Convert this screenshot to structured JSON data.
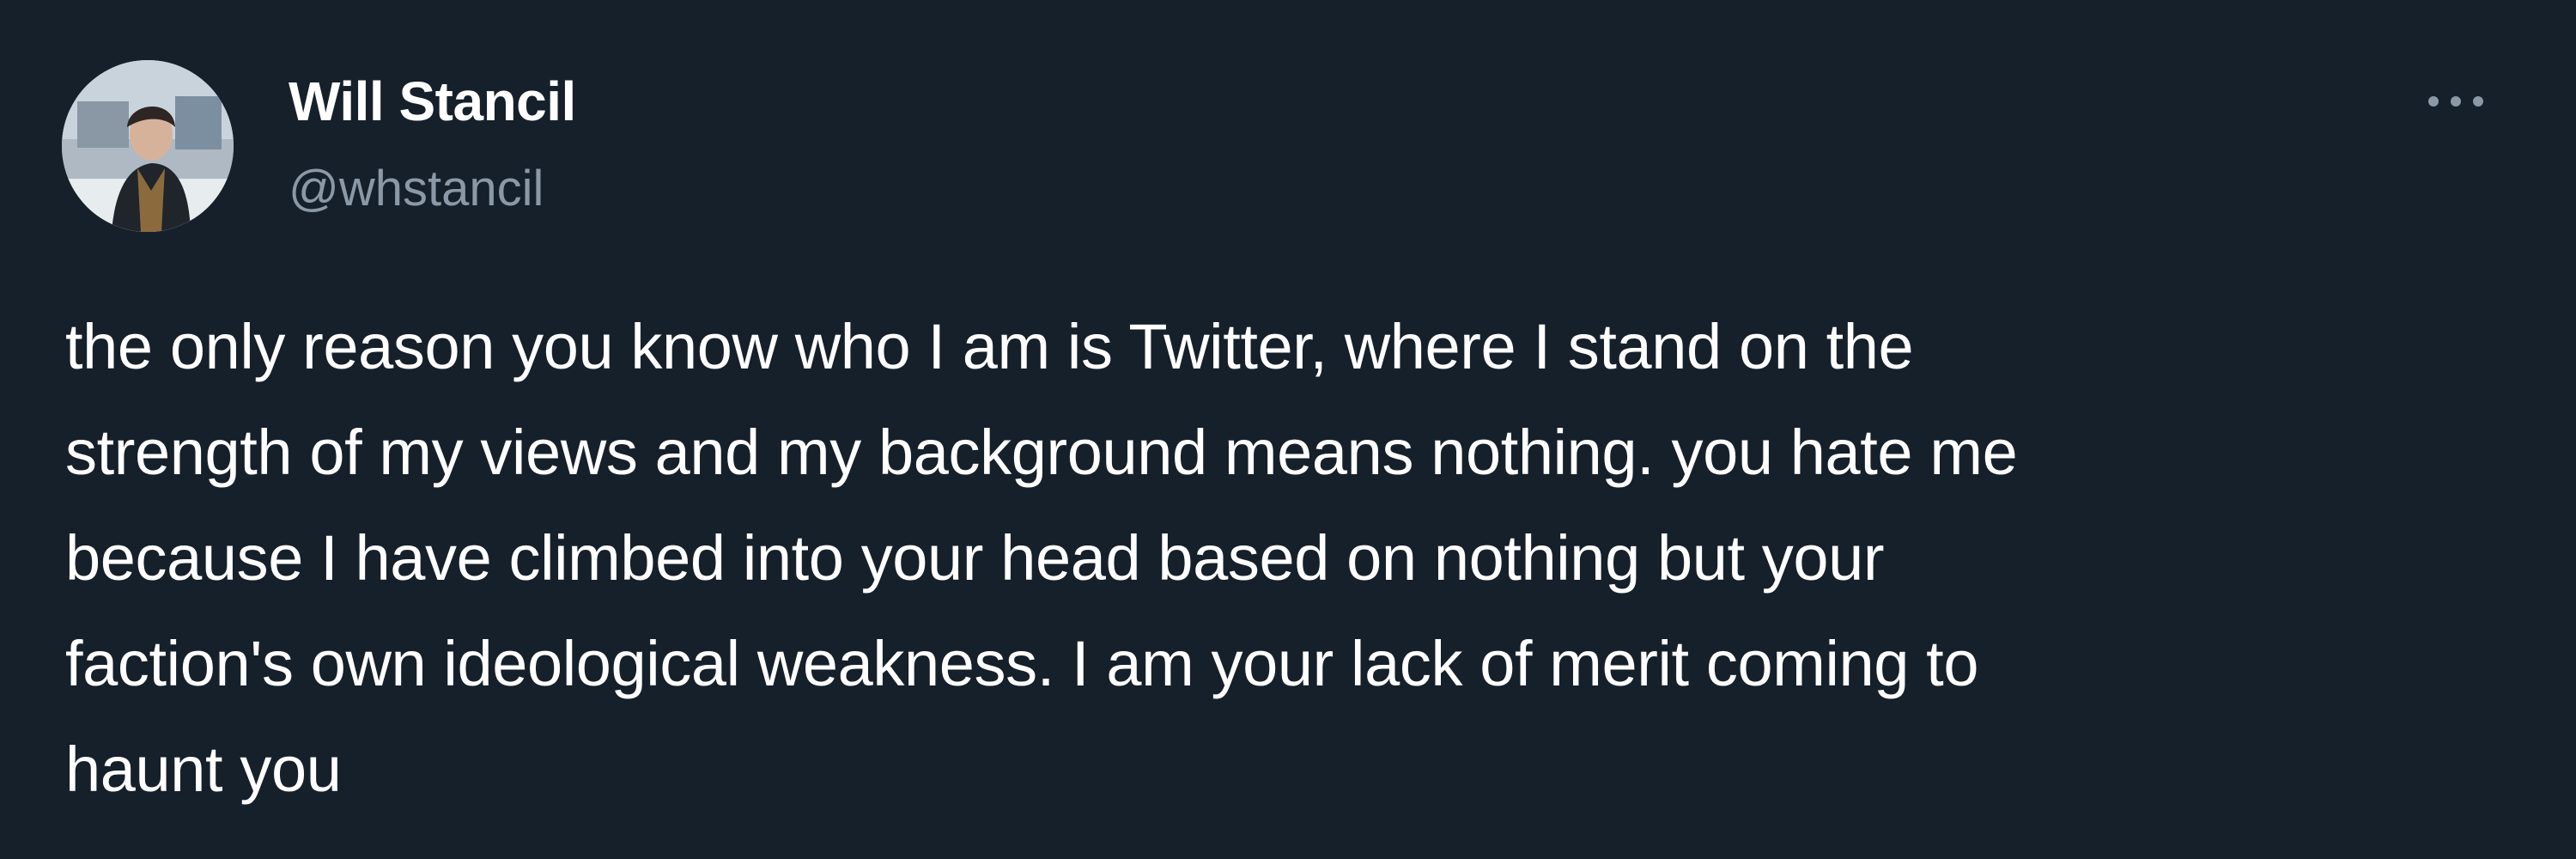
{
  "tweet": {
    "author": {
      "display_name": "Will Stancil",
      "handle": "@whstancil",
      "avatar_icon": "profile-photo"
    },
    "more_menu": {
      "icon": "more-horizontal-icon"
    },
    "text": "the only reason you know who I am is Twitter, where I stand on the\nstrength of my views and my background means nothing. you hate me\nbecause I have climbed into your head based on nothing but your\nfaction's own ideological weakness. I am your lack of merit coming to\nhaunt you"
  },
  "colors": {
    "background": "#16202b",
    "primary_text": "#ffffff",
    "secondary_text": "#8b98a5"
  }
}
